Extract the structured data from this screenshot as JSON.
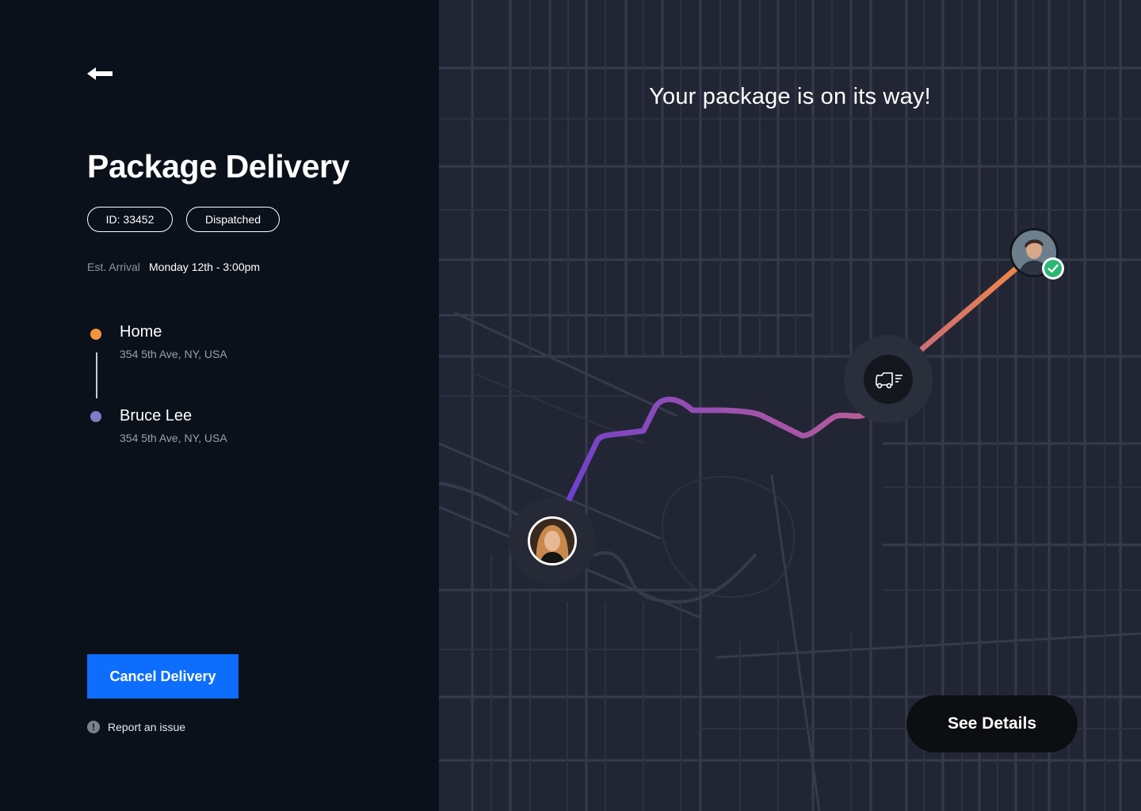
{
  "sidebar": {
    "back_icon": "arrow-left-icon",
    "title": "Package Delivery",
    "id_badge": "ID: 33452",
    "status_badge": "Dispatched",
    "est_label": "Est. Arrival",
    "est_value": "Monday 12th - 3:00pm",
    "stops": [
      {
        "name": "Home",
        "address": "354 5th Ave, NY, USA",
        "color": "#f5923e"
      },
      {
        "name": "Bruce Lee",
        "address": "354 5th Ave, NY, USA",
        "color": "#7c7fc6"
      }
    ],
    "cancel_label": "Cancel Delivery",
    "report_icon": "alert-circle-icon",
    "report_label": "Report an issue"
  },
  "map": {
    "headline": "Your package is on its way!",
    "see_details_label": "See Details",
    "truck_icon": "truck-icon",
    "check_icon": "check-badge-icon",
    "route_colors": {
      "start": "#6a3fd0",
      "mid": "#b35a9e",
      "end": "#f58a3c"
    }
  },
  "colors": {
    "background": "#0b111b",
    "map_background": "#222634",
    "primary_button": "#0d6efd"
  }
}
